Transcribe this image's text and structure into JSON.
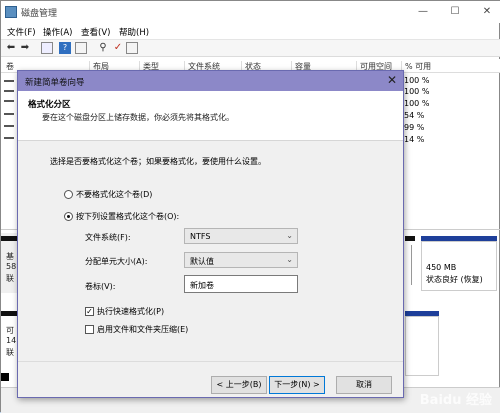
{
  "window": {
    "title": "磁盘管理"
  },
  "menu": [
    "文件(F)",
    "操作(A)",
    "查看(V)",
    "帮助(H)"
  ],
  "toolbar_icons": [
    "back-icon",
    "forward-icon",
    "grid-icon",
    "help-icon",
    "list-icon",
    "connect-icon",
    "check-icon",
    "properties-icon"
  ],
  "columns": [
    "卷",
    "布局",
    "类型",
    "文件系统",
    "状态",
    "容量",
    "可用空间",
    "% 可用"
  ],
  "pct_rows": [
    "100 %",
    "100 %",
    "100 %",
    "54 %",
    "99 %",
    "14 %"
  ],
  "lower": {
    "disk_label_1": "基",
    "disk_label_2": "58",
    "disk_label_3": "联",
    "right_size": "450 MB",
    "right_status": "状态良好 (恢复)",
    "disk2_label_1": "可",
    "disk2_label_2": "14",
    "disk2_label_3": "联"
  },
  "dialog": {
    "title": "新建简单卷向导",
    "close": "✕",
    "header_title": "格式化分区",
    "header_sub": "要在这个磁盘分区上储存数据，你必须先将其格式化。",
    "prompt": "选择是否要格式化这个卷；如果要格式化，要使用什么设置。",
    "radio_no": "不要格式化这个卷(D)",
    "radio_yes": "按下列设置格式化这个卷(O):",
    "fs_label": "文件系统(F):",
    "fs_value": "NTFS",
    "unit_label": "分配单元大小(A):",
    "unit_value": "默认值",
    "vol_label": "卷标(V):",
    "vol_value": "新加卷",
    "quick_format": "执行快速格式化(P)",
    "compress": "启用文件和文件夹压缩(E)",
    "back": "< 上一步(B)",
    "next": "下一步(N) >",
    "cancel": "取消"
  },
  "watermark": "Baidu 经验"
}
